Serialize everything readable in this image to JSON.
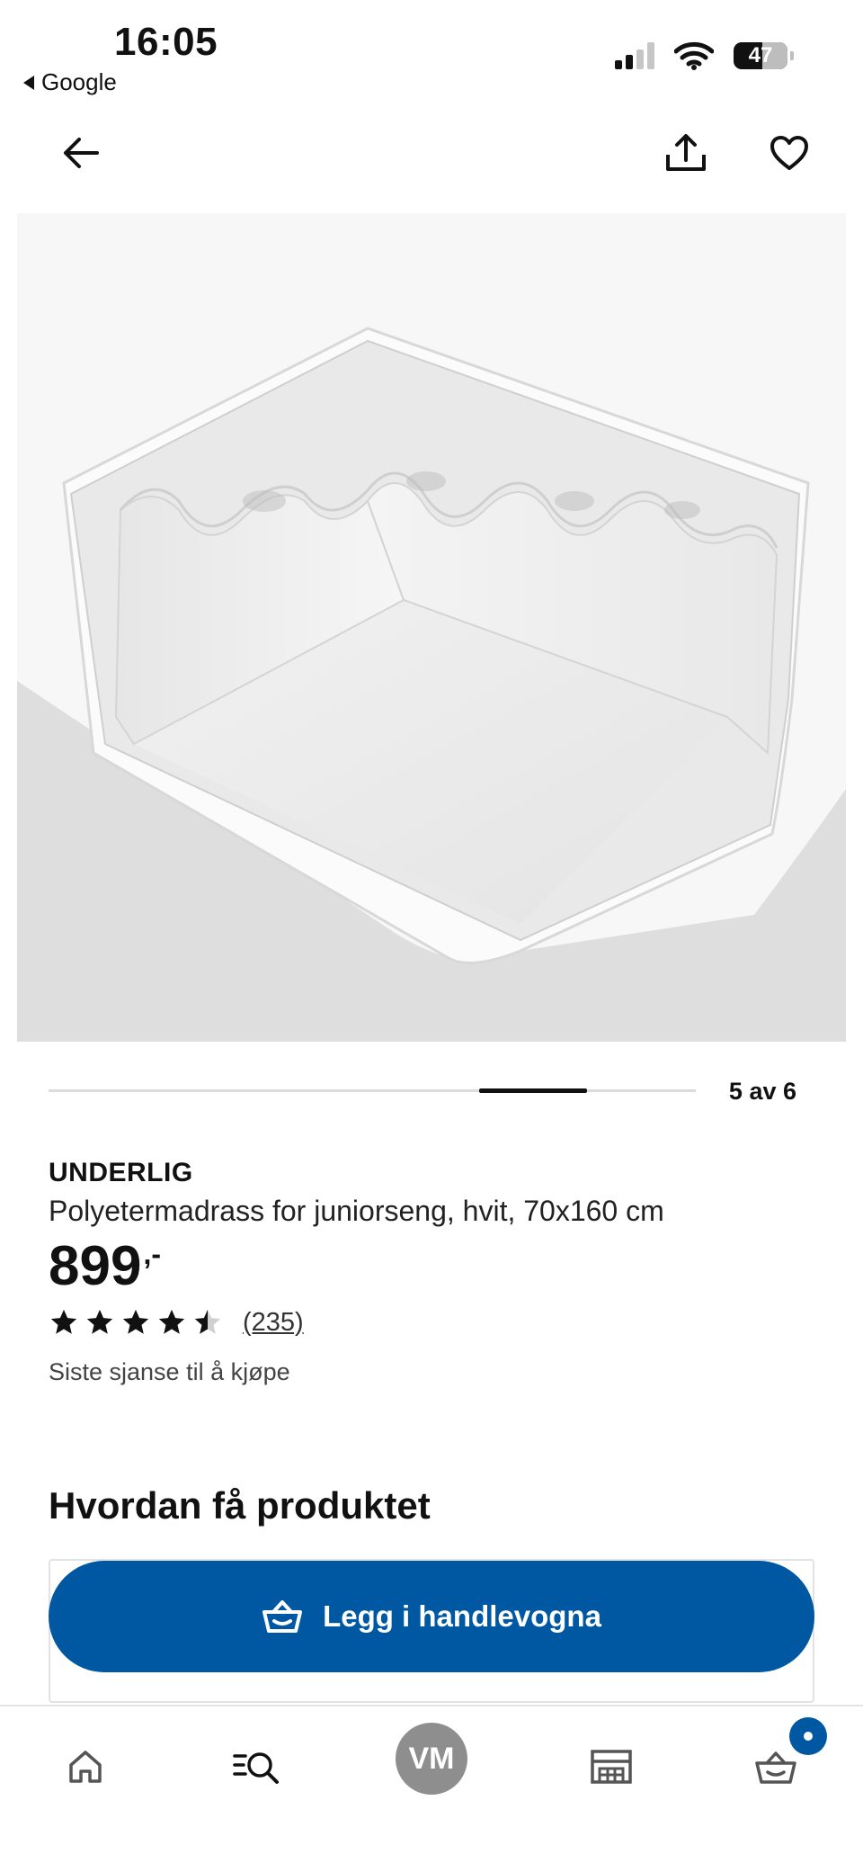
{
  "status_bar": {
    "time": "16:05",
    "back_app": "Google",
    "battery": "47",
    "signal_bars_active": 2,
    "signal_bars_total": 4
  },
  "nav": {
    "back_icon": "arrow-left-icon",
    "share_icon": "share-icon",
    "favorite_icon": "heart-icon"
  },
  "gallery": {
    "counter": "5 av 6",
    "current": 5,
    "total": 6
  },
  "product": {
    "brand": "UNDERLIG",
    "description": "Polyetermadrass for juniorseng, hvit, 70x160 cm",
    "price": "899",
    "price_suffix": ",-",
    "rating": 4.5,
    "rating_max": 5,
    "reviews": "(235)",
    "availability": "Siste sjanse til å kjøpe"
  },
  "delivery": {
    "title": "Hvordan få produktet",
    "cart_button_label": "Legg i handlevogna"
  },
  "bottom_nav": {
    "avatar_initials": "VM",
    "items": [
      "home-icon",
      "search-icon",
      "profile-avatar",
      "store-icon",
      "cart-icon"
    ]
  },
  "colors": {
    "accent": "#0058a3",
    "text": "#111111",
    "avatar": "#8e8e8e"
  }
}
